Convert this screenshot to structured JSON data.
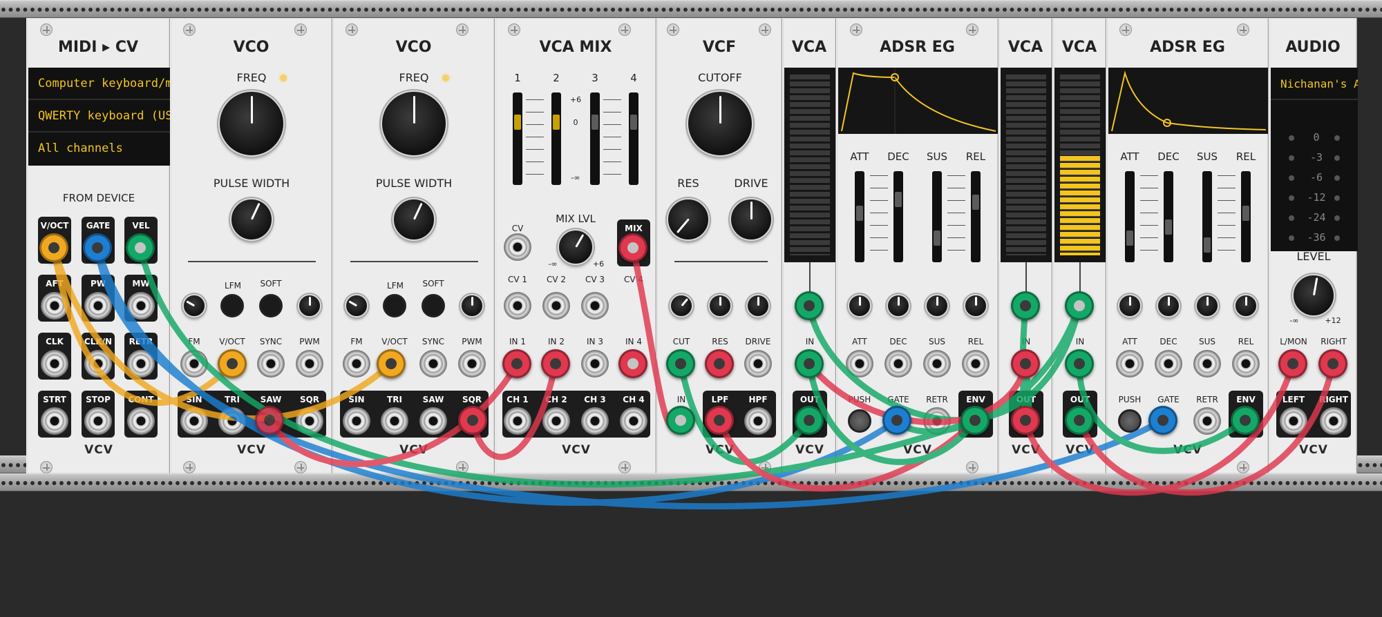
{
  "colors": {
    "panel": "#ececec",
    "cable_yellow": "#f0a820",
    "cable_blue": "#1c7fd1",
    "cable_green": "#14a866",
    "cable_red": "#e0384f",
    "display_text": "#f3c51d"
  },
  "brand": "VCV",
  "modules": {
    "midi": {
      "title": "MIDI ▸ CV",
      "driver": "Computer keyboard/m",
      "device": "QWERTY keyboard (US",
      "channel": "All channels",
      "section": "FROM DEVICE",
      "jacks": [
        "V/OCT",
        "GATE",
        "VEL",
        "AFT",
        "PW",
        "MW",
        "CLK",
        "CLK/N",
        "RETR",
        "STRT",
        "STOP",
        "CONT"
      ]
    },
    "vco1": {
      "title": "VCO",
      "freq": "FREQ",
      "pw": "PULSE WIDTH",
      "lfm": "LFM",
      "soft": "SOFT",
      "inputs": [
        "FM",
        "V/OCT",
        "SYNC",
        "PWM"
      ],
      "outputs": [
        "SIN",
        "TRI",
        "SAW",
        "SQR"
      ]
    },
    "vco2": {
      "title": "VCO",
      "freq": "FREQ",
      "pw": "PULSE WIDTH",
      "lfm": "LFM",
      "soft": "SOFT",
      "inputs": [
        "FM",
        "V/OCT",
        "SYNC",
        "PWM"
      ],
      "outputs": [
        "SIN",
        "TRI",
        "SAW",
        "SQR"
      ]
    },
    "vcamix": {
      "title": "VCA MIX",
      "channels": [
        "1",
        "2",
        "3",
        "4"
      ],
      "scale": [
        "+6",
        "0",
        "-∞"
      ],
      "cv": "CV",
      "mixlvl": "MIX LVL",
      "mixmin": "-∞",
      "mixmax": "+6",
      "mix": "MIX",
      "cvs": [
        "CV 1",
        "CV 2",
        "CV 3",
        "CV 4"
      ],
      "ins": [
        "IN 1",
        "IN 2",
        "IN 3",
        "IN 4"
      ],
      "outs": [
        "CH 1",
        "CH 2",
        "CH 3",
        "CH 4"
      ]
    },
    "vcf": {
      "title": "VCF",
      "cutoff": "CUTOFF",
      "res": "RES",
      "drive": "DRIVE",
      "cvlabels": [
        "CUT",
        "RES",
        "DRIVE"
      ],
      "in": "IN",
      "lpf": "LPF",
      "hpf": "HPF"
    },
    "vca1": {
      "title": "VCA",
      "in": "IN",
      "out": "OUT"
    },
    "adsr1": {
      "title": "ADSR EG",
      "params": [
        "ATT",
        "DEC",
        "SUS",
        "REL"
      ],
      "push": "PUSH",
      "gate": "GATE",
      "retr": "RETR",
      "env": "ENV"
    },
    "vca2": {
      "title": "VCA",
      "in": "IN",
      "out": "OUT"
    },
    "vca3": {
      "title": "VCA",
      "in": "IN",
      "out": "OUT",
      "level": 0.55
    },
    "adsr2": {
      "title": "ADSR EG",
      "params": [
        "ATT",
        "DEC",
        "SUS",
        "REL"
      ],
      "push": "PUSH",
      "gate": "GATE",
      "retr": "RETR",
      "env": "ENV"
    },
    "audio": {
      "title": "AUDIO",
      "device": "Nichanan's A",
      "db": [
        "0",
        "-3",
        "-6",
        "-12",
        "-24",
        "-36"
      ],
      "level": "LEVEL",
      "lmin": "-∞",
      "lmax": "+12",
      "inputs": [
        "L/MON",
        "RIGHT"
      ],
      "outputs": [
        "LEFT",
        "RIGHT"
      ]
    }
  }
}
